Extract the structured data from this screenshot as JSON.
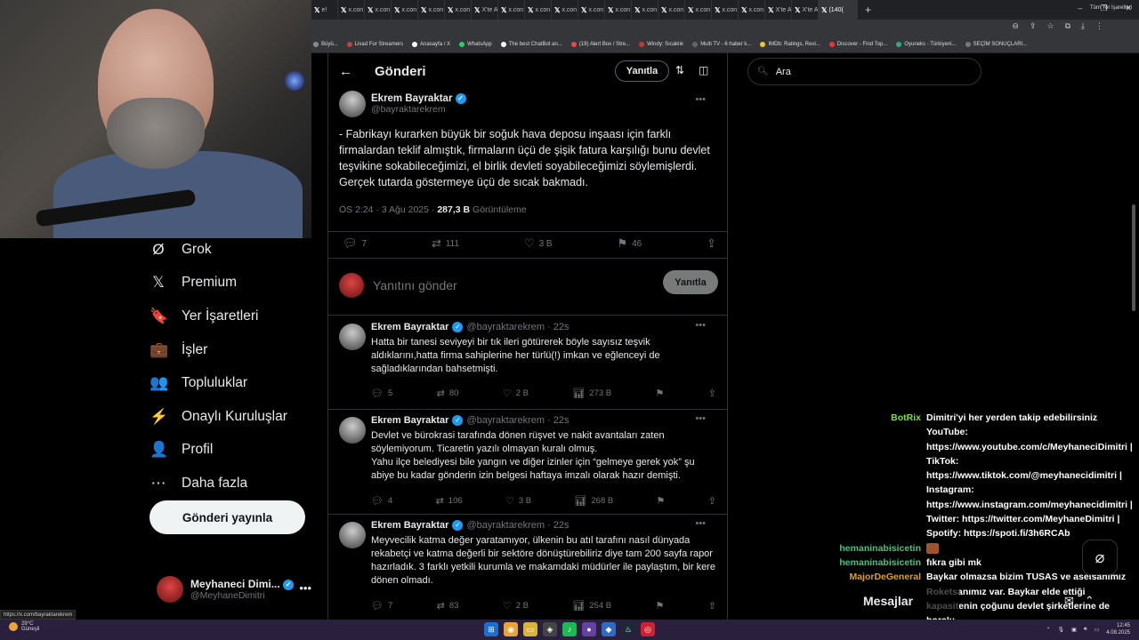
{
  "browser": {
    "tabs": [
      "e!",
      "x.con",
      "x.con",
      "x.con",
      "x.con",
      "x.con",
      "X'te A",
      "x.con",
      "x.con",
      "x.con",
      "x.con",
      "x.con",
      "x.con",
      "x.con",
      "x.con",
      "x.con",
      "x.con",
      "X'te A",
      "X'te A",
      "(140("
    ],
    "bookmarks": [
      "Büyü...",
      "Livad For Streamers",
      "Anasayfa / X",
      "WhatsApp",
      "The best ChatBot an...",
      "(19) Alert Box / Stre...",
      "Windy: Sıcaklık",
      "Multi TV - 6 haber k...",
      "IMDb: Ratings, Revi...",
      "Discover - Find Top...",
      "Oyuneks - Türkiyeni...",
      "SEÇİM SONUÇLARI..."
    ],
    "bookmarks_right": "Tüm Yer İşaretleri"
  },
  "nav": {
    "items": [
      {
        "label": "Grok",
        "icon": "Ø"
      },
      {
        "label": "Premium",
        "icon": "𝕏"
      },
      {
        "label": "Yer İşaretleri",
        "icon": "🔖"
      },
      {
        "label": "İşler",
        "icon": "💼"
      },
      {
        "label": "Topluluklar",
        "icon": "👥"
      },
      {
        "label": "Onaylı Kuruluşlar",
        "icon": "⚡"
      },
      {
        "label": "Profil",
        "icon": "👤"
      },
      {
        "label": "Daha fazla",
        "icon": "⋯"
      }
    ],
    "post_button": "Gönderi yayınla",
    "account": {
      "name": "Meyhaneci Dimi...",
      "handle": "@MeyhaneDimitri"
    }
  },
  "main": {
    "title": "Gönderi",
    "reply_pill": "Yanıtla",
    "tweet": {
      "name": "Ekrem Bayraktar",
      "handle": "@bayraktarekrem",
      "text": "- Fabrikayı kurarken büyük bir soğuk hava deposu inşaası için farklı firmalardan teklif almıştık, firmaların üçü de şişik fatura karşılığı bunu devlet teşvikine sokabileceğimizi, el birlik devleti soyabileceğimizi söylemişlerdi. Gerçek tutarda göstermeye üçü de sıcak bakmadı.",
      "time": "ÖS 2:24 · 3 Ağu 2025 · ",
      "views": "287,3 B",
      "views_label": " Görüntüleme",
      "replies": "7",
      "retweets": "111",
      "likes": "3 B",
      "bookmarks": "46"
    },
    "compose": {
      "placeholder": "Yanıtını gönder",
      "button": "Yanıtla"
    },
    "replies": [
      {
        "name": "Ekrem Bayraktar",
        "meta": "@bayraktarekrem · 22s",
        "text": "Hatta bir tanesi seviyeyi bir tık ileri götürerek böyle sayısız teşvik aldıklarını,hatta firma sahiplerine her türlü(!) imkan ve eğlenceyi de sağladıklarından bahsetmişti.",
        "replies": "5",
        "retweets": "80",
        "likes": "2 B",
        "views": "273 B"
      },
      {
        "name": "Ekrem Bayraktar",
        "meta": "@bayraktarekrem · 22s",
        "text": "Devlet ve bürokrasi tarafında dönen rüşvet ve nakit avantaları zaten söylemiyorum. Ticaretin yazılı olmayan kuralı olmuş.\nYahu ilçe belediyesi bile yangın ve diğer izinler için “gelmeye gerek yok” şu abiye bu kadar gönderin izin belgesi haftaya imzalı olarak hazır demişti.",
        "replies": "4",
        "retweets": "106",
        "likes": "3 B",
        "views": "268 B"
      },
      {
        "name": "Ekrem Bayraktar",
        "meta": "@bayraktarekrem · 22s",
        "text": "Meyvecilik katma değer yaratamıyor, ülkenin bu atıl tarafını nasıl dünyada rekabetçi ve katma değerli bir sektöre dönüştürebiliriz diye tam 200 sayfa rapor hazırladık. 3 farklı yetkili kurumla ve makamdaki müdürler ile paylaştım, bir kere dönen olmadı.",
        "replies": "7",
        "retweets": "83",
        "likes": "2 B",
        "views": "254 B"
      }
    ]
  },
  "right": {
    "search_placeholder": "Ara"
  },
  "chat": [
    {
      "user": "BotRix",
      "color": "#7fdc3a",
      "msg": "Dimitri'yi her yerden takip edebilirsiniz YouTube: https://www.youtube.com/c/MeyhaneciDimitri | TikTok: https://www.tiktok.com/@meyhanecidimitri | Instagram: https://www.instagram.com/meyhanecidimitri | Twitter: https://twitter.com/MeyhaneDimitri | Spotify: https://spoti.fi/3h6RCAb"
    },
    {
      "user": "hemaninabisicetin",
      "color": "#3ec97a",
      "msg": "",
      "emote": true
    },
    {
      "user": "hemaninabisicetin",
      "color": "#3ec97a",
      "msg": "fıkra gibi mk"
    },
    {
      "user": "MajorDeGeneral",
      "color": "#e0a020",
      "msg": "Baykar olmazsa bizim TUSAS ve aselsanımız Roketsanımız var. Baykar elde ettiği kapasitenin çoğunu devlet şirketlerine de borçlu"
    }
  ],
  "mesajlar": "Mesajlar",
  "status_link": "https://x.com/bayraktarekrem",
  "taskbar": {
    "temp": "29°C",
    "weather": "Güneşli",
    "time": "12:45",
    "date": "4.08.2025"
  }
}
